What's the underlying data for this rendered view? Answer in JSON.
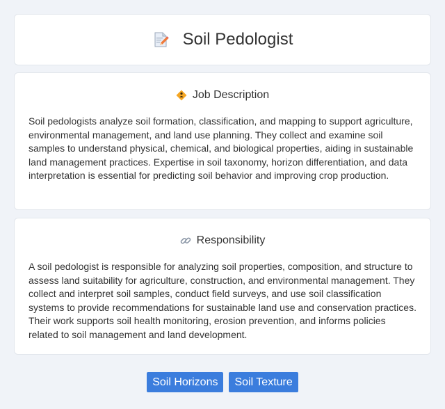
{
  "header": {
    "title": "Soil Pedologist",
    "icon": "document-pencil-icon"
  },
  "job_description": {
    "heading": "Job Description",
    "icon": "diamond-worker-icon",
    "text": "Soil pedologists analyze soil formation, classification, and mapping to support agriculture, environmental management, and land use planning. They collect and examine soil samples to understand physical, chemical, and biological properties, aiding in sustainable land management practices. Expertise in soil taxonomy, horizon differentiation, and data interpretation is essential for predicting soil behavior and improving crop production."
  },
  "responsibility": {
    "heading": "Responsibility",
    "icon": "link-icon",
    "text": "A soil pedologist is responsible for analyzing soil properties, composition, and structure to assess land suitability for agriculture, construction, and environmental management. They collect and interpret soil samples, conduct field surveys, and use soil classification systems to provide recommendations for sustainable land use and conservation practices. Their work supports soil health monitoring, erosion prevention, and informs policies related to soil management and land development."
  },
  "tags": [
    {
      "label": "Soil Horizons"
    },
    {
      "label": "Soil Texture"
    }
  ],
  "colors": {
    "background": "#f0f3f8",
    "card": "#ffffff",
    "tag": "#3b7ddd",
    "text": "#333333"
  }
}
